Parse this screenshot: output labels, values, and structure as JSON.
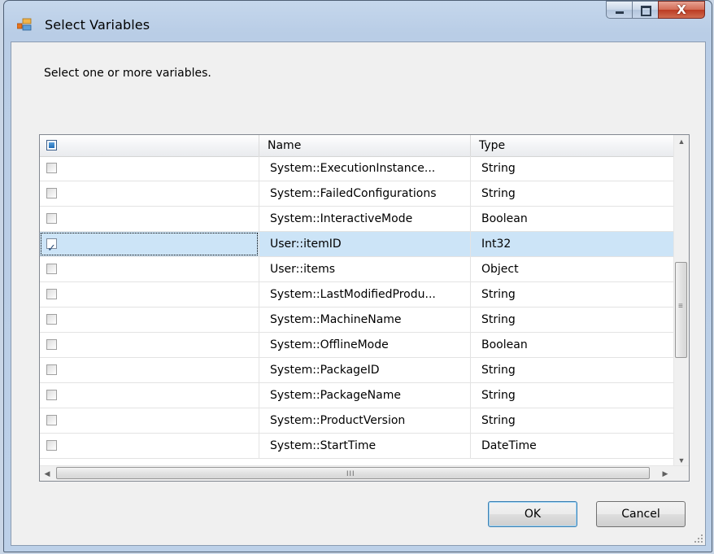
{
  "window": {
    "title": "Select Variables",
    "close_glyph": "X"
  },
  "instruction": "Select one or more variables.",
  "grid": {
    "columns": [
      "",
      "Name",
      "Type"
    ],
    "rows": [
      {
        "checked": false,
        "name": "System::ExecutionInstance...",
        "type": "String"
      },
      {
        "checked": false,
        "name": "System::FailedConfigurations",
        "type": "String"
      },
      {
        "checked": false,
        "name": "System::InteractiveMode",
        "type": "Boolean"
      },
      {
        "checked": true,
        "name": "User::itemID",
        "type": "Int32",
        "selected": true
      },
      {
        "checked": false,
        "name": "User::items",
        "type": "Object"
      },
      {
        "checked": false,
        "name": "System::LastModifiedProdu...",
        "type": "String"
      },
      {
        "checked": false,
        "name": "System::MachineName",
        "type": "String"
      },
      {
        "checked": false,
        "name": "System::OfflineMode",
        "type": "Boolean"
      },
      {
        "checked": false,
        "name": "System::PackageID",
        "type": "String"
      },
      {
        "checked": false,
        "name": "System::PackageName",
        "type": "String"
      },
      {
        "checked": false,
        "name": "System::ProductVersion",
        "type": "String"
      },
      {
        "checked": false,
        "name": "System::StartTime",
        "type": "DateTime"
      }
    ]
  },
  "scroll": {
    "h_grip": "III",
    "v_grip": "≡"
  },
  "buttons": {
    "ok": "OK",
    "cancel": "Cancel"
  },
  "colors": {
    "selected_row": "#cce4f7",
    "title_bar": "#c5d7ec",
    "close_button": "#c7442c"
  }
}
